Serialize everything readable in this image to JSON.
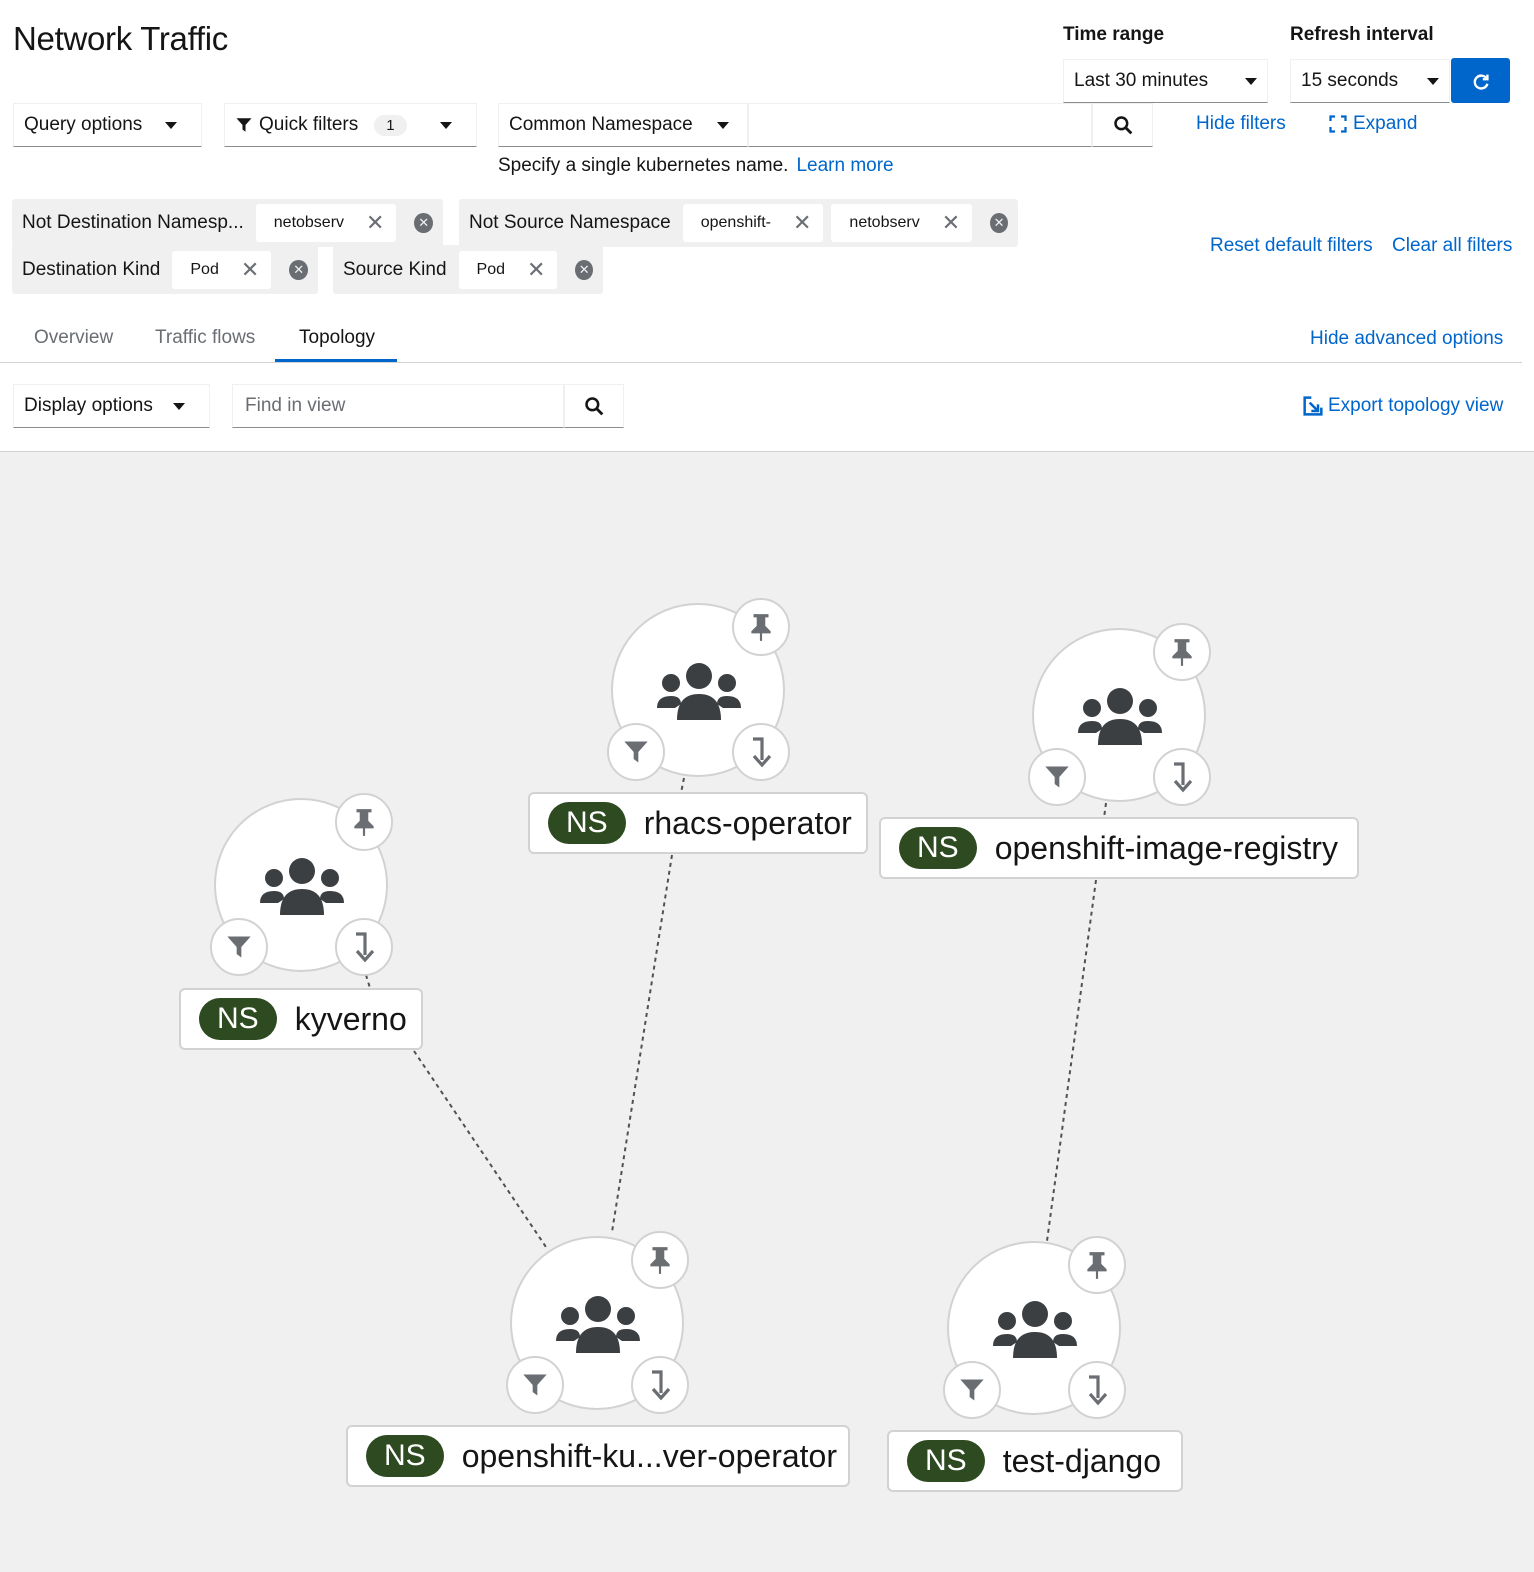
{
  "header": {
    "title": "Network Traffic"
  },
  "time_range": {
    "label": "Time range",
    "value": "Last 30 minutes"
  },
  "refresh": {
    "label": "Refresh interval",
    "value": "15 seconds"
  },
  "toolbar": {
    "query_options": "Query options",
    "quick_filters": "Quick filters",
    "quick_filters_count": "1",
    "filter_field": "Common Namespace",
    "search_value": "",
    "hint": "Specify a single kubernetes name.",
    "learn_more": "Learn more",
    "hide_filters": "Hide filters",
    "expand": "Expand"
  },
  "filters": {
    "groups": [
      {
        "category": "Not Destination Namesp...",
        "chips": [
          "netobserv"
        ]
      },
      {
        "category": "Not Source Namespace",
        "chips": [
          "openshift-",
          "netobserv"
        ]
      },
      {
        "category": "Destination Kind",
        "chips": [
          "Pod"
        ]
      },
      {
        "category": "Source Kind",
        "chips": [
          "Pod"
        ]
      }
    ],
    "reset": "Reset default filters",
    "clear": "Clear all filters"
  },
  "tabs": {
    "items": [
      "Overview",
      "Traffic flows",
      "Topology"
    ],
    "active": "Topology",
    "hide_advanced": "Hide advanced options"
  },
  "view_toolbar": {
    "display_options": "Display options",
    "find_placeholder": "Find in view",
    "export": "Export topology view"
  },
  "topology": {
    "nodes": [
      {
        "badge": "NS",
        "name": "rhacs-operator"
      },
      {
        "badge": "NS",
        "name": "openshift-image-registry"
      },
      {
        "badge": "NS",
        "name": "kyverno"
      },
      {
        "badge": "NS",
        "name": "openshift-ku...ver-operator"
      },
      {
        "badge": "NS",
        "name": "test-django"
      }
    ]
  },
  "colors": {
    "accent": "#0066cc",
    "ns_badge": "#2d4a21",
    "canvas": "#f0f0f0"
  },
  "icons": [
    "filter-icon",
    "search-icon",
    "expand-icon",
    "refresh-icon",
    "close-icon",
    "remove-group-icon",
    "export-icon",
    "group-icon",
    "pin-icon",
    "step-into-icon"
  ]
}
